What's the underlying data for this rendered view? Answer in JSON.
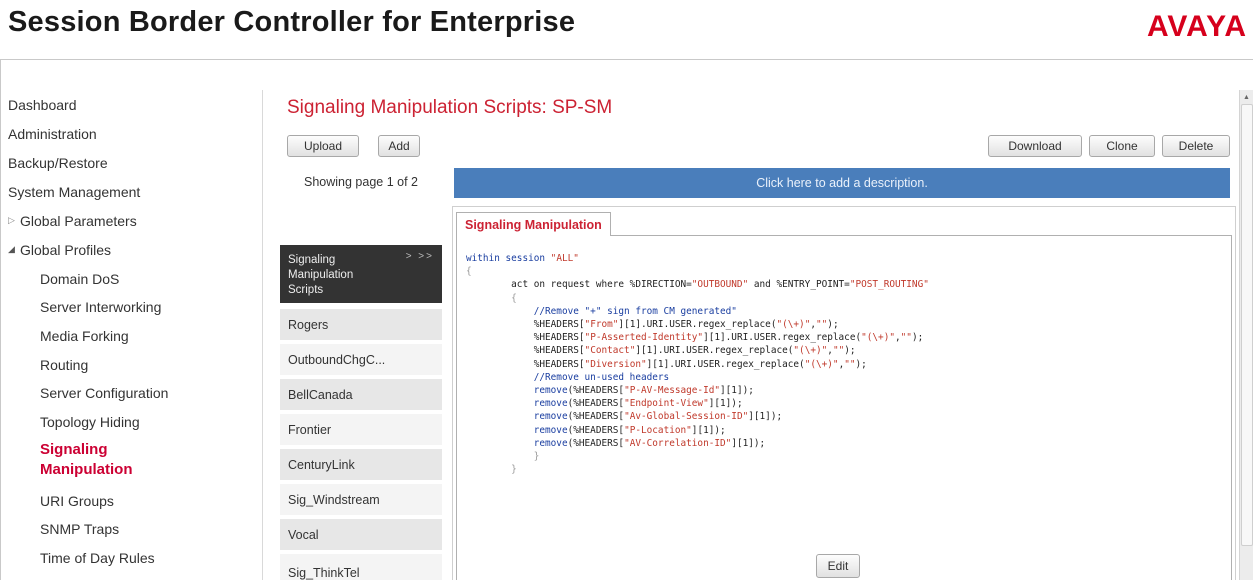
{
  "app": {
    "title": "Session Border Controller for Enterprise",
    "logo": "AVAYA",
    "colors": {
      "brand_red": "#cc2233",
      "desc_bar_blue": "#4a7ebb",
      "list_header": "#333333"
    }
  },
  "sidebar": {
    "items": [
      {
        "label": "Dashboard"
      },
      {
        "label": "Administration"
      },
      {
        "label": "Backup/Restore"
      },
      {
        "label": "System Management"
      },
      {
        "label": "Global Parameters"
      },
      {
        "label": "Global Profiles"
      },
      {
        "label": "Domain DoS"
      },
      {
        "label": "Server Interworking"
      },
      {
        "label": "Media Forking"
      },
      {
        "label": "Routing"
      },
      {
        "label": "Server Configuration"
      },
      {
        "label": "Topology Hiding"
      },
      {
        "label": "Signaling Manipulation"
      },
      {
        "label": "URI Groups"
      },
      {
        "label": "SNMP Traps"
      },
      {
        "label": "Time of Day Rules"
      }
    ]
  },
  "main": {
    "page_title": "Signaling Manipulation Scripts: SP-SM",
    "buttons": {
      "upload": "Upload",
      "add": "Add",
      "download": "Download",
      "clone": "Clone",
      "delete": "Delete",
      "edit": "Edit"
    },
    "paging_text": "Showing page 1 of 2",
    "list": {
      "header": "Signaling Manipulation Scripts",
      "header_arrows": "> >>",
      "items": [
        "Rogers",
        "OutboundChgC...",
        "BellCanada",
        "Frontier",
        "CenturyLink",
        "Sig_Windstream",
        "Vocal",
        "Sig_ThinkTel"
      ]
    },
    "description_placeholder": "Click here to add a description.",
    "tab_label": "Signaling Manipulation"
  }
}
